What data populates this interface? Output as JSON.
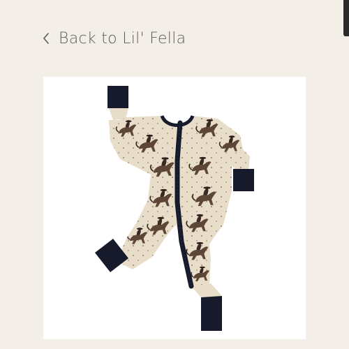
{
  "nav": {
    "back_label": "Back to Lil' Fella",
    "back_icon": "chevron-left-icon"
  },
  "product": {
    "image_alt": "Cowboy bronco print zip romper",
    "colors": {
      "fabric": "#e8ddc9",
      "trim": "#161a2b",
      "print": "#6a5443"
    }
  },
  "colors": {
    "page_background": "#f3efe8",
    "text": "#5f5a55"
  }
}
